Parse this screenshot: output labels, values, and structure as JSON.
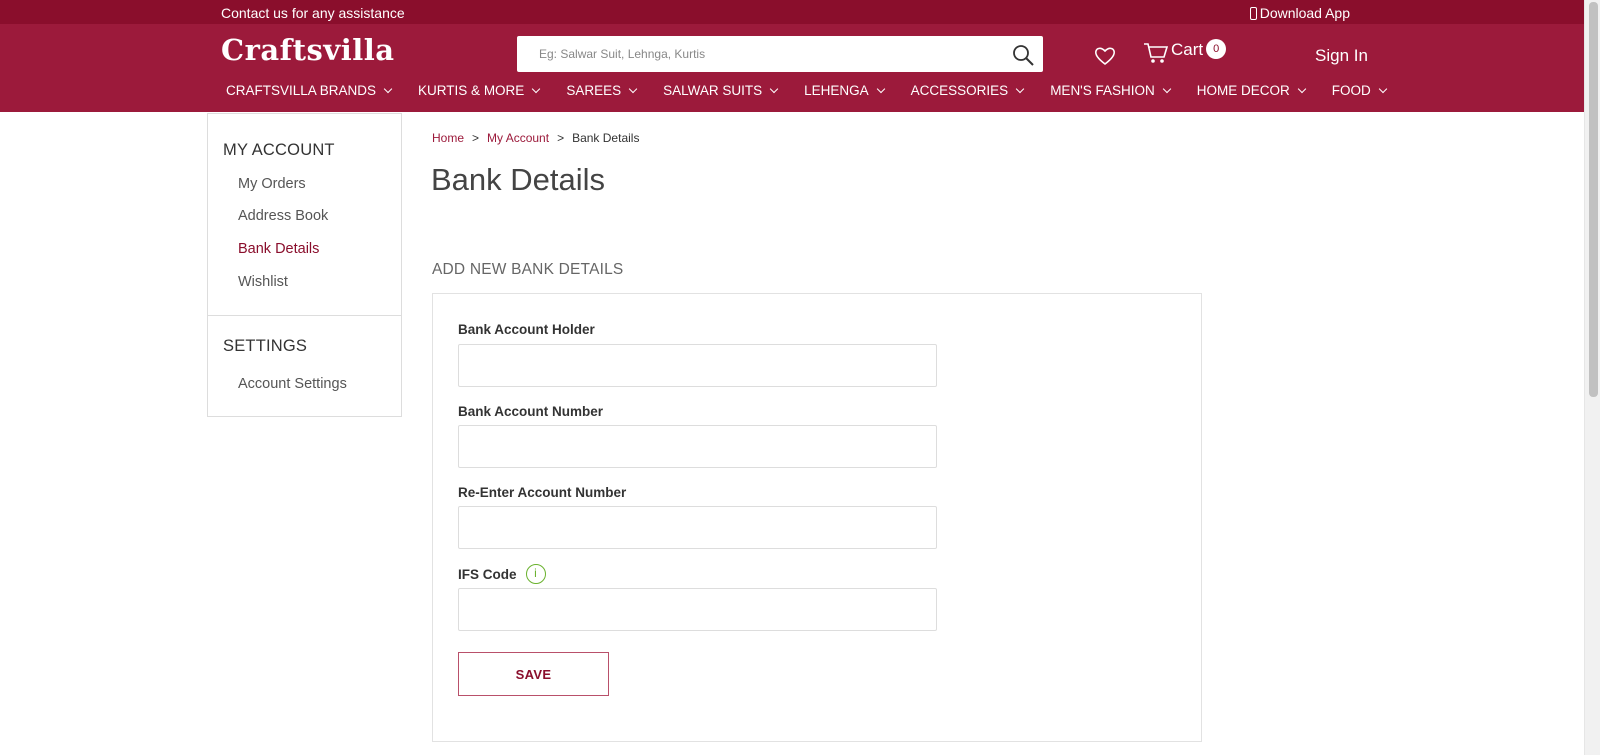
{
  "topbar": {
    "contact_text": "Contact us for any assistance",
    "download_label": "Download App"
  },
  "header": {
    "logo_text": "Craftsvilla",
    "search_placeholder": "Eg: Salwar Suit, Lehnga, Kurtis",
    "cart_label": "Cart",
    "cart_count": "0",
    "signin_label": "Sign In"
  },
  "nav": {
    "items": [
      {
        "label": "CRAFTSVILLA BRANDS"
      },
      {
        "label": "KURTIS & MORE"
      },
      {
        "label": "SAREES"
      },
      {
        "label": "SALWAR SUITS"
      },
      {
        "label": "LEHENGA"
      },
      {
        "label": "ACCESSORIES"
      },
      {
        "label": "MEN'S FASHION"
      },
      {
        "label": "HOME DECOR"
      },
      {
        "label": "FOOD"
      }
    ]
  },
  "sidebar": {
    "account_title": "MY ACCOUNT",
    "account_links": [
      {
        "label": "My Orders"
      },
      {
        "label": "Address Book"
      },
      {
        "label": "Bank Details"
      },
      {
        "label": "Wishlist"
      }
    ],
    "settings_title": "SETTINGS",
    "settings_links": [
      {
        "label": "Account Settings"
      }
    ]
  },
  "breadcrumb": {
    "items": [
      "Home",
      "My Account",
      "Bank Details"
    ],
    "separator": ">"
  },
  "page": {
    "title": "Bank Details",
    "section_title": "ADD NEW BANK DETAILS"
  },
  "form": {
    "holder_label": "Bank Account Holder",
    "holder_value": "",
    "number_label": "Bank Account Number",
    "number_value": "",
    "reenter_label": "Re-Enter Account Number",
    "reenter_value": "",
    "ifsc_label": "IFS Code",
    "ifsc_info_glyph": "i",
    "ifsc_value": "",
    "save_label": "SAVE"
  },
  "colors": {
    "brand": "#9c1a3b",
    "topbar": "#8a0e2c",
    "info": "#6ab22e"
  }
}
